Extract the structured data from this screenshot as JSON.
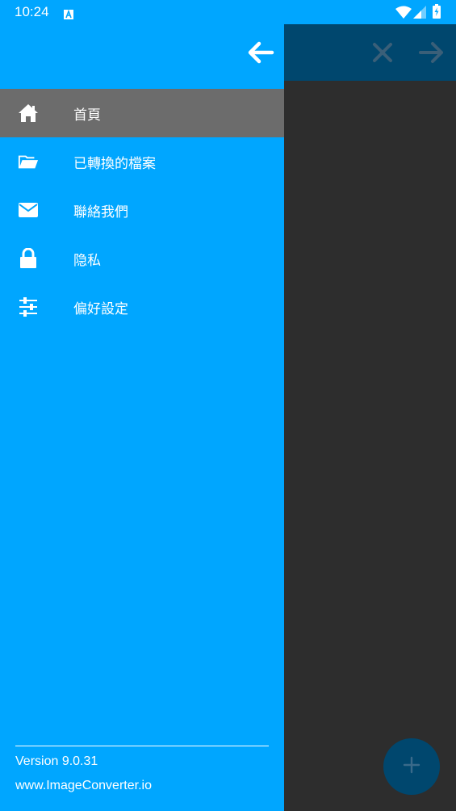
{
  "status_bar": {
    "time": "10:24",
    "notification_icon": "a-letter-icon",
    "icons": [
      "wifi-icon",
      "signal-icon",
      "battery-charging-icon"
    ]
  },
  "background_app": {
    "toolbar_icons": [
      "close-icon",
      "arrow-right-icon"
    ],
    "fab_icon": "plus-icon"
  },
  "drawer": {
    "back_icon": "arrow-left-icon",
    "items": [
      {
        "label": "首頁",
        "icon": "home-icon",
        "active": true
      },
      {
        "label": "已轉換的檔案",
        "icon": "folder-open-icon",
        "active": false
      },
      {
        "label": "聯絡我們",
        "icon": "envelope-icon",
        "active": false
      },
      {
        "label": "隐私",
        "icon": "lock-icon",
        "active": false
      },
      {
        "label": "偏好設定",
        "icon": "sliders-icon",
        "active": false
      }
    ],
    "footer": {
      "version": "Version 9.0.31",
      "website": "www.ImageConverter.io"
    }
  },
  "colors": {
    "drawer_bg": "#00a6ff",
    "active_item_bg": "#6c6c6c",
    "dim_toolbar": "#00476e",
    "dim_background": "#2d2d2d",
    "text": "#ffffff"
  }
}
